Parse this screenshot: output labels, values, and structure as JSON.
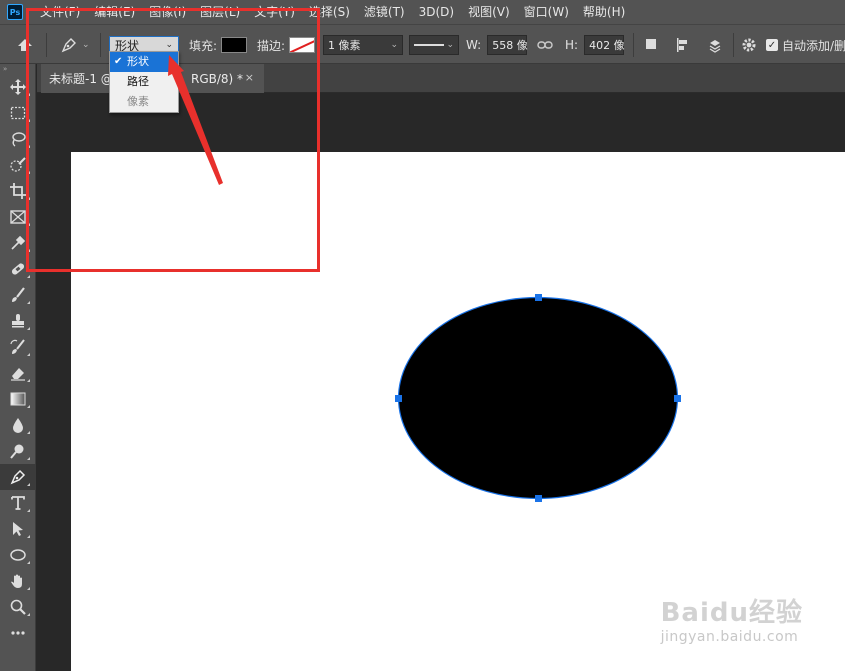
{
  "app": {
    "logo": "Ps"
  },
  "menu": [
    "文件(F)",
    "编辑(E)",
    "图像(I)",
    "图层(L)",
    "文字(Y)",
    "选择(S)",
    "滤镜(T)",
    "3D(D)",
    "视图(V)",
    "窗口(W)",
    "帮助(H)"
  ],
  "options": {
    "mode_value": "形状",
    "fill_label": "填充:",
    "stroke_label": "描边:",
    "stroke_width": "1 像素",
    "w_label": "W:",
    "w_value": "558 像",
    "h_label": "H:",
    "h_value": "402 像",
    "auto_add_label": "自动添加/删"
  },
  "mode_dropdown": {
    "items": [
      "形状",
      "路径",
      "像素"
    ],
    "selected": "形状",
    "disabled": "像素"
  },
  "toolbar": {
    "header": "»"
  },
  "document": {
    "tab_name": "未标题-1 @",
    "tab_suffix": "RGB/8) *",
    "close_glyph": "×"
  },
  "shape": {
    "fill": "#000000",
    "stroke": "#1a73e8",
    "type": "ellipse"
  },
  "colors": {
    "annotation": "#e8302c",
    "selection": "#1a73d6",
    "chrome": "#535353"
  },
  "watermark": {
    "main": "Baidu经验",
    "sub": "jingyan.baidu.com"
  }
}
